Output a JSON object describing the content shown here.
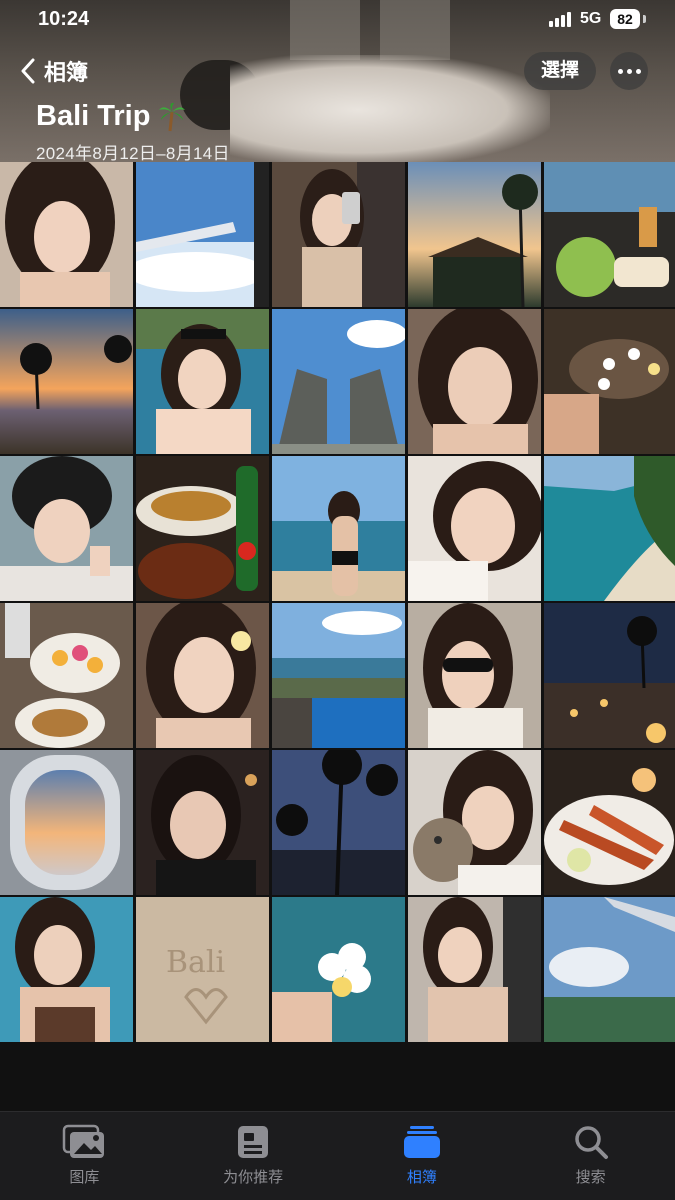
{
  "status_bar": {
    "time": "10:24",
    "network": "5G",
    "battery": "82"
  },
  "nav": {
    "back_label": "相簿",
    "select_label": "選擇",
    "more_icon": "ellipsis-icon"
  },
  "album": {
    "title": "Bali Trip",
    "date_range": "2024年8月12日–8月14日"
  },
  "photos": [
    "selfie-hand-on-chin",
    "airplane-wing-clouds",
    "mirror-selfie",
    "palm-sunset-hut",
    "coconut-drink-table",
    "beach-sunset-palms",
    "pool-selfie-sunglasses",
    "temple-gate",
    "wink-selfie",
    "flower-foot-bath",
    "helmet-peace-sign",
    "dinner-table-beer",
    "beach-bikini-back",
    "lying-selfie",
    "cliff-beach-aerial",
    "fruit-breakfast",
    "flower-in-hair-selfie",
    "resort-infinity-pool",
    "sunglasses-selfie",
    "candlelit-beach-dinner",
    "airplane-window-sunset",
    "night-bar-selfie",
    "night-palms-beach",
    "cat-selfie",
    "lobster-dinner",
    "pool-bikini-selfie",
    "sand-writing-bali",
    "frangipani-hand",
    "hallway-selfie",
    "aerial-coast-wing"
  ],
  "tabs": [
    {
      "label": "图库",
      "icon": "photos-library-icon",
      "active": false
    },
    {
      "label": "为你推荐",
      "icon": "for-you-icon",
      "active": false
    },
    {
      "label": "相簿",
      "icon": "albums-icon",
      "active": true
    },
    {
      "label": "搜索",
      "icon": "search-icon",
      "active": false
    }
  ],
  "colors": {
    "accent": "#2f80ff",
    "tab_inactive": "#8e8e93",
    "tab_bar_bg": "#1c1c1e"
  }
}
